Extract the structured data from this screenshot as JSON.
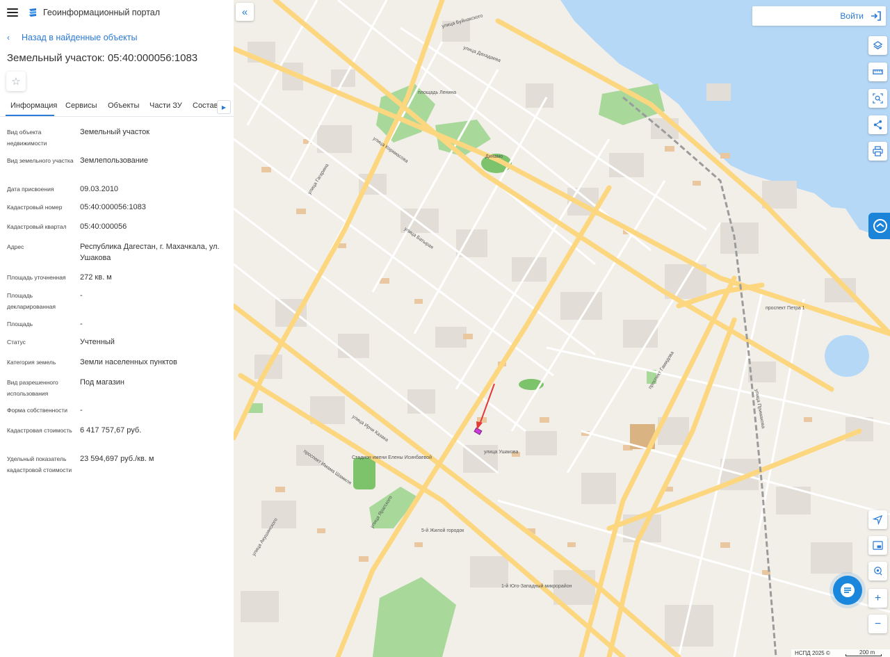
{
  "header": {
    "title": "Геоинформационный портал",
    "menu_icon": "menu-icon",
    "logo_icon": "portal-logo"
  },
  "back_link": {
    "label": "Назад в найденные объекты"
  },
  "object": {
    "title": "Земельный участок: 05:40:000056:1083"
  },
  "tabs": [
    {
      "label": "Информация",
      "active": true
    },
    {
      "label": "Сервисы",
      "active": false
    },
    {
      "label": "Объекты",
      "active": false
    },
    {
      "label": "Части ЗУ",
      "active": false
    },
    {
      "label": "Состав",
      "active": false
    }
  ],
  "info": {
    "rows": [
      {
        "label": "Вид объекта недвижимости",
        "value": "Земельный участок"
      },
      {
        "label": "Вид земельного участка",
        "value": "Землепользование"
      },
      {
        "label": "Дата присвоения",
        "value": "09.03.2010"
      },
      {
        "label": "Кадастровый номер",
        "value": "05:40:000056:1083"
      },
      {
        "label": "Кадастровый квартал",
        "value": "05:40:000056"
      },
      {
        "label": "Адрес",
        "value": "Республика Дагестан, г. Махачкала, ул. Ушакова"
      },
      {
        "label": "Площадь уточненная",
        "value": "272 кв. м"
      },
      {
        "label": "Площадь декларированная",
        "value": "-"
      },
      {
        "label": "Площадь",
        "value": "-"
      },
      {
        "label": "Статус",
        "value": "Учтенный"
      },
      {
        "label": "Категория земель",
        "value": "Земли населенных пунктов"
      },
      {
        "label": "Вид разрешенного использования",
        "value": "Под магазин"
      },
      {
        "label": "Форма собственности",
        "value": "-"
      },
      {
        "label": "Кадастровая стоимость",
        "value": "6 417 757,67 руб."
      },
      {
        "label": "Удельный показатель кадастровой стоимости",
        "value": "23 594,697 руб./кв. м"
      }
    ]
  },
  "map": {
    "login_label": "Войти",
    "attribution": "НСПД 2025 ©",
    "scale_label": "200 m",
    "colors": {
      "water": "#b6d8f7",
      "road_major": "#fcd77f",
      "park": "#a8d99b",
      "accent": "#2a7ad8",
      "marker": "#e53935"
    },
    "labels": [
      "улица Гагарина",
      "улица Батырая",
      "улица Коркмасова",
      "улица Ирчи Казака",
      "проспект Имама Шамиля",
      "площадь Ленина",
      "Динамо",
      "улица Ушакова",
      "проспект Гамидова",
      "улица Ярагского",
      "улица Буйнакского",
      "улица Дахадаева",
      "1-й Юго-Западный микрорайон",
      "5-й Жилой городок",
      "проспект Петра 1",
      "Стадион имени Елены Исинбаевой",
      "улица Акушинского",
      "улица Примакова"
    ]
  }
}
